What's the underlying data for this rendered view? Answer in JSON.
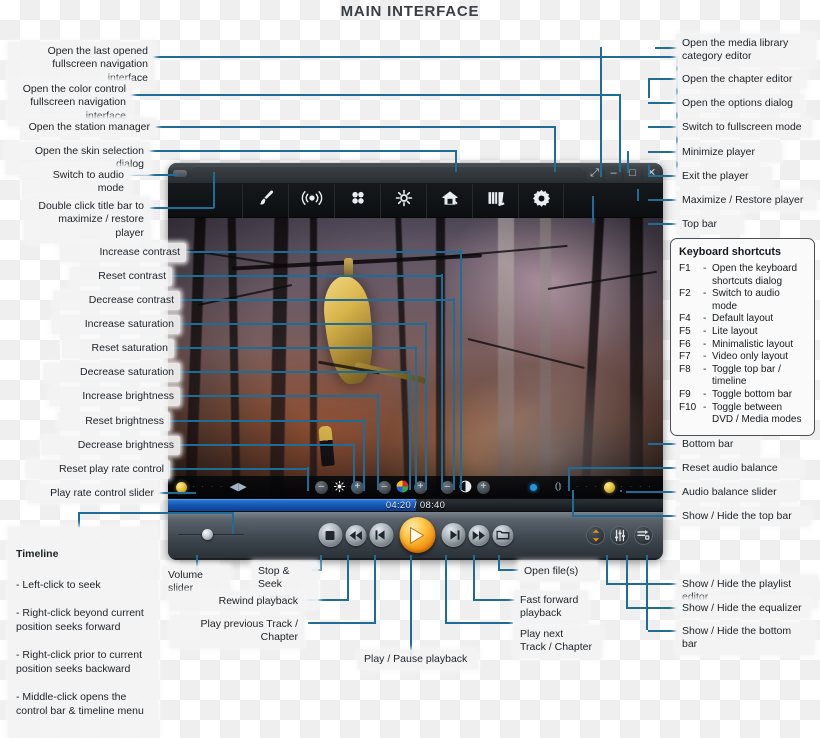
{
  "page": {
    "title": "MAIN INTERFACE"
  },
  "callouts_left": [
    {
      "id": "last-fullscreen-nav",
      "text": "Open the last opened\nfullscreen navigation interface"
    },
    {
      "id": "color-control-nav",
      "text": "Open the color control\nfullscreen navigation interface"
    },
    {
      "id": "station-manager",
      "text": "Open the station manager"
    },
    {
      "id": "skin-selection",
      "text": "Open the skin selection dialog"
    },
    {
      "id": "switch-audio-mode",
      "text": "Switch to audio mode"
    },
    {
      "id": "double-click-titlebar",
      "text": "Double click title bar to\nmaximize / restore player"
    },
    {
      "id": "increase-contrast",
      "text": "Increase contrast"
    },
    {
      "id": "reset-contrast",
      "text": "Reset contrast"
    },
    {
      "id": "decrease-contrast",
      "text": "Decrease contrast"
    },
    {
      "id": "increase-saturation",
      "text": "Increase saturation"
    },
    {
      "id": "reset-saturation",
      "text": "Reset saturation"
    },
    {
      "id": "decrease-saturation",
      "text": "Decrease saturation"
    },
    {
      "id": "increase-brightness",
      "text": "Increase brightness"
    },
    {
      "id": "reset-brightness",
      "text": "Reset brightness"
    },
    {
      "id": "decrease-brightness",
      "text": "Decrease brightness"
    },
    {
      "id": "reset-play-rate",
      "text": "Reset play rate control"
    },
    {
      "id": "play-rate-slider",
      "text": "Play rate control slider"
    }
  ],
  "callouts_right": [
    {
      "id": "media-library-category",
      "text": "Open the media library\ncategory editor"
    },
    {
      "id": "chapter-editor",
      "text": "Open the chapter editor"
    },
    {
      "id": "options-dialog",
      "text": "Open the options dialog"
    },
    {
      "id": "fullscreen-mode",
      "text": "Switch to fullscreen mode"
    },
    {
      "id": "minimize-player",
      "text": "Minimize player"
    },
    {
      "id": "exit-player",
      "text": "Exit the player"
    },
    {
      "id": "maximize-restore",
      "text": "Maximize / Restore player"
    },
    {
      "id": "top-bar",
      "text": "Top bar"
    },
    {
      "id": "bottom-bar",
      "text": "Bottom bar"
    },
    {
      "id": "reset-audio-balance",
      "text": "Reset audio balance"
    },
    {
      "id": "audio-balance-slider",
      "text": "Audio balance slider"
    },
    {
      "id": "show-hide-top-bar",
      "text": "Show / Hide the top bar"
    },
    {
      "id": "show-hide-playlist",
      "text": "Show / Hide the playlist editor"
    },
    {
      "id": "show-hide-equalizer",
      "text": "Show / Hide the equalizer"
    },
    {
      "id": "show-hide-bottom-bar",
      "text": "Show / Hide the bottom bar"
    }
  ],
  "callouts_bottom": [
    {
      "id": "volume-slider",
      "text": "Volume slider"
    },
    {
      "id": "stop-seek-start",
      "text": "Stop & Seek\nto start"
    },
    {
      "id": "rewind",
      "text": "Rewind playback"
    },
    {
      "id": "prev-track",
      "text": "Play previous Track / Chapter"
    },
    {
      "id": "play-pause",
      "text": "Play / Pause playback"
    },
    {
      "id": "next-track",
      "text": "Play next\nTrack / Chapter"
    },
    {
      "id": "fast-forward",
      "text": "Fast forward\nplayback"
    },
    {
      "id": "open-files",
      "text": "Open file(s)"
    }
  ],
  "timeline_note": {
    "title": "Timeline",
    "lines": [
      "- Left-click to seek",
      "- Right-click beyond current\n  position seeks forward",
      "- Right-click prior to current\n  position seeks backward",
      "- Middle-click opens the\n  control bar & timeline menu"
    ]
  },
  "keyboard_shortcuts": {
    "title": "Keyboard shortcuts",
    "rows": [
      {
        "key": "F1",
        "dash": "-",
        "desc": "Open the keyboard\nshortcuts dialog"
      },
      {
        "key": "F2",
        "dash": "-",
        "desc": "Switch to audio mode"
      },
      {
        "key": "F4",
        "dash": "-",
        "desc": "Default layout"
      },
      {
        "key": "F5",
        "dash": "-",
        "desc": "Lite layout"
      },
      {
        "key": "F6",
        "dash": "-",
        "desc": "Minimalistic layout"
      },
      {
        "key": "F7",
        "dash": "-",
        "desc": "Video only layout"
      },
      {
        "key": "F8",
        "dash": "-",
        "desc": "Toggle top bar / timeline"
      },
      {
        "key": "F9",
        "dash": "-",
        "desc": "Toggle bottom bar"
      },
      {
        "key": "F10",
        "dash": "-",
        "desc": "Toggle between\nDVD / Media modes"
      }
    ]
  },
  "player": {
    "window_buttons": [
      {
        "id": "fullscreen-button",
        "glyph": "⤢"
      },
      {
        "id": "minimize-button",
        "glyph": "–"
      },
      {
        "id": "maximize-button",
        "glyph": "□"
      },
      {
        "id": "close-button",
        "glyph": "✕"
      }
    ],
    "toolbar_icons": [
      {
        "id": "skin-brush-icon",
        "name": "brush-icon"
      },
      {
        "id": "station-radio-icon",
        "name": "radio-wave-icon"
      },
      {
        "id": "color-dots-icon",
        "name": "color-dots-icon"
      },
      {
        "id": "brightness-icon",
        "name": "sun-icon"
      },
      {
        "id": "media-library-icon",
        "name": "library-house-icon"
      },
      {
        "id": "chapter-book-icon",
        "name": "book-icon"
      },
      {
        "id": "options-gear-icon",
        "name": "gear-icon"
      }
    ],
    "timeline": {
      "current": "04:20",
      "separator": "/",
      "total": "08:40",
      "display": "04:20 / 08:40",
      "progress_percent": 50
    },
    "dot_trail": "· · · ·",
    "adjust_controls": {
      "brightness": {
        "minus": "–",
        "plus": "+"
      },
      "saturation": {
        "minus": "–",
        "plus": "+"
      },
      "contrast": {
        "minus": "–",
        "plus": "+"
      }
    },
    "transport": [
      {
        "id": "stop-button",
        "glyph": "■"
      },
      {
        "id": "rewind-button",
        "glyph": "◀◀"
      },
      {
        "id": "prev-button",
        "glyph": "◀▌"
      },
      {
        "id": "play-button",
        "glyph": "▶"
      },
      {
        "id": "next-button",
        "glyph": "▌▶"
      },
      {
        "id": "forward-button",
        "glyph": "▶▶"
      },
      {
        "id": "open-button",
        "glyph": "▱"
      }
    ],
    "right_buttons": [
      {
        "id": "playlist-toggle-button",
        "glyph": "⇅"
      },
      {
        "id": "equalizer-toggle-button",
        "glyph": "⫶"
      },
      {
        "id": "bottombar-toggle-button",
        "glyph": "⇥"
      }
    ]
  },
  "colors": {
    "leader_line": "#1f6d96",
    "accent_blue": "#2196de",
    "play_orange": "#ef8e0c",
    "timeline_blue": "#1657b4",
    "knob_gold": "#e8c43c"
  }
}
